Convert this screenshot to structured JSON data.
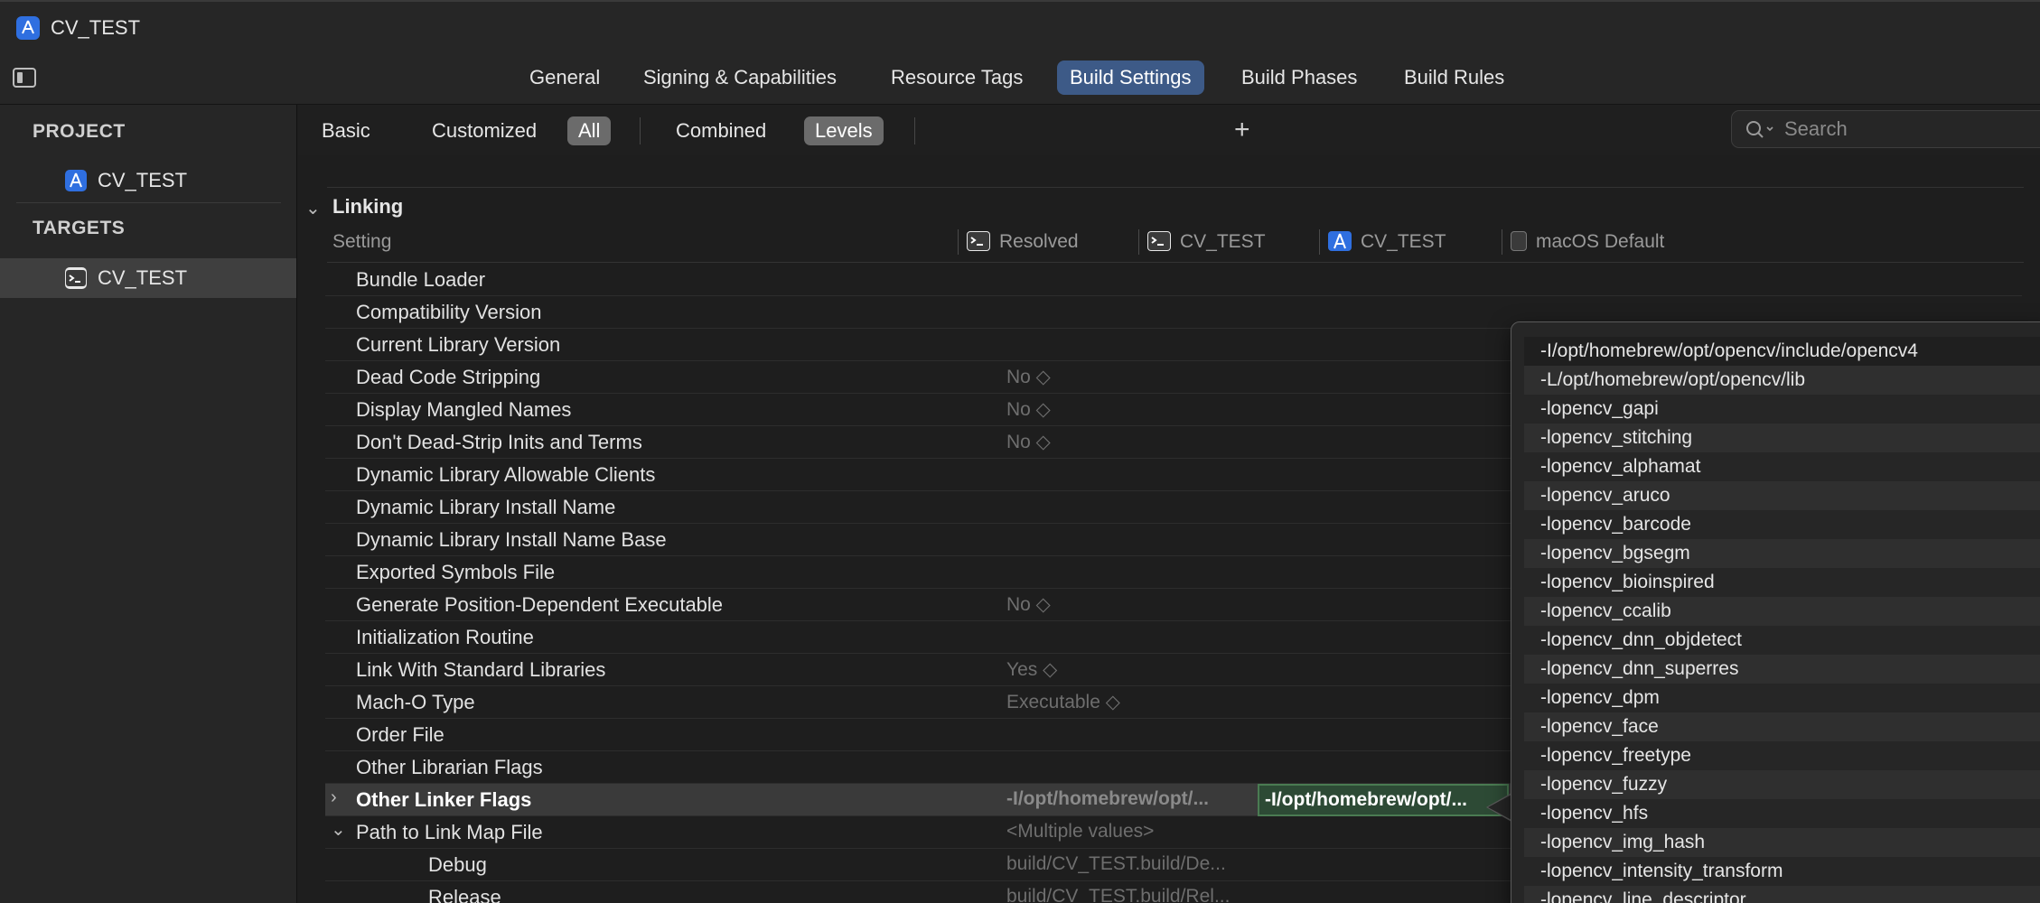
{
  "window": {
    "title": "CV_TEST"
  },
  "tabs": [
    {
      "label": "General"
    },
    {
      "label": "Signing & Capabilities"
    },
    {
      "label": "Resource Tags"
    },
    {
      "label": "Build Settings",
      "active": true
    },
    {
      "label": "Build Phases"
    },
    {
      "label": "Build Rules"
    }
  ],
  "sidebar": {
    "project_header": "PROJECT",
    "project_item": "CV_TEST",
    "targets_header": "TARGETS",
    "target_item": "CV_TEST"
  },
  "filters": {
    "basic": "Basic",
    "customized": "Customized",
    "all": "All",
    "combined": "Combined",
    "levels": "Levels",
    "add": "+",
    "search_placeholder": "Search"
  },
  "section": {
    "title": "Linking",
    "columns": {
      "setting": "Setting",
      "resolved": "Resolved",
      "target": "CV_TEST",
      "project": "CV_TEST",
      "default": "macOS Default"
    }
  },
  "rows": [
    {
      "name": "Bundle Loader",
      "value": ""
    },
    {
      "name": "Compatibility Version",
      "value": ""
    },
    {
      "name": "Current Library Version",
      "value": ""
    },
    {
      "name": "Dead Code Stripping",
      "value": "No ◇"
    },
    {
      "name": "Display Mangled Names",
      "value": "No ◇"
    },
    {
      "name": "Don't Dead-Strip Inits and Terms",
      "value": "No ◇"
    },
    {
      "name": "Dynamic Library Allowable Clients",
      "value": ""
    },
    {
      "name": "Dynamic Library Install Name",
      "value": ""
    },
    {
      "name": "Dynamic Library Install Name Base",
      "value": ""
    },
    {
      "name": "Exported Symbols File",
      "value": ""
    },
    {
      "name": "Generate Position-Dependent Executable",
      "value": "No ◇"
    },
    {
      "name": "Initialization Routine",
      "value": ""
    },
    {
      "name": "Link With Standard Libraries",
      "value": "Yes ◇"
    },
    {
      "name": "Mach-O Type",
      "value": "Executable ◇"
    },
    {
      "name": "Order File",
      "value": ""
    },
    {
      "name": "Other Librarian Flags",
      "value": ""
    },
    {
      "name": "Other Linker Flags",
      "value": "-I/opt/homebrew/opt/...",
      "edit_value": "-I/opt/homebrew/opt/..."
    },
    {
      "name": "Path to Link Map File",
      "value": "<Multiple values>"
    },
    {
      "name": "Debug",
      "value": "build/CV_TEST.build/De..."
    },
    {
      "name": "Release",
      "value": "build/CV_TEST.build/Rel..."
    }
  ],
  "popover_items": [
    "-I/opt/homebrew/opt/opencv/include/opencv4",
    "-L/opt/homebrew/opt/opencv/lib",
    "-lopencv_gapi",
    "-lopencv_stitching",
    "-lopencv_alphamat",
    "-lopencv_aruco",
    "-lopencv_barcode",
    "-lopencv_bgsegm",
    "-lopencv_bioinspired",
    "-lopencv_ccalib",
    "-lopencv_dnn_objdetect",
    "-lopencv_dnn_superres",
    "-lopencv_dpm",
    "-lopencv_face",
    "-lopencv_freetype",
    "-lopencv_fuzzy",
    "-lopencv_hfs",
    "-lopencv_img_hash",
    "-lopencv_intensity_transform",
    "-lopencv_line_descriptor"
  ]
}
